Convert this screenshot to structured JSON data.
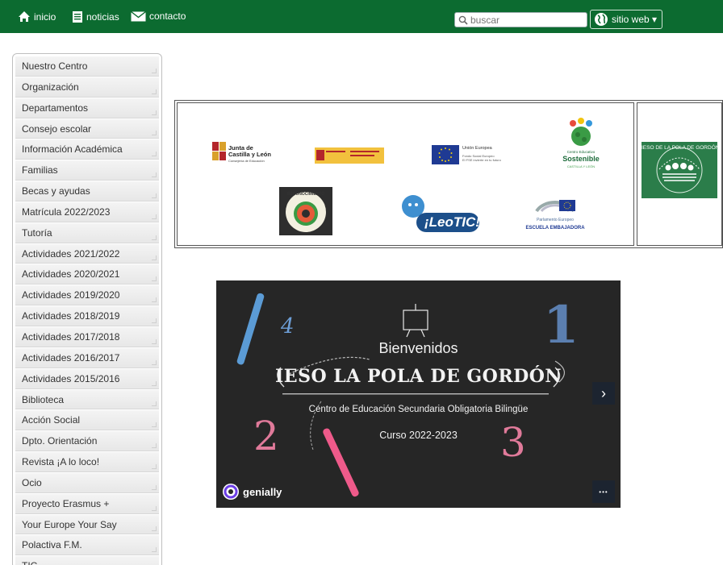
{
  "topbar": {
    "links": [
      {
        "label": "inicio",
        "icon": "home-icon"
      },
      {
        "label": "noticias",
        "icon": "document-icon"
      },
      {
        "label": "contacto",
        "icon": "envelope-icon"
      }
    ],
    "search": {
      "placeholder": "buscar",
      "icon": "search-icon"
    },
    "site_button": {
      "label": "sitio web ▾",
      "icon": "globe-icon"
    },
    "background": "#0c6b30"
  },
  "sidebar": {
    "items": [
      "Nuestro Centro",
      "Organización",
      "Departamentos",
      "Consejo escolar",
      "Información Académica",
      "Familias",
      "Becas y ayudas",
      "Matrícula 2022/2023",
      "Tutoría",
      "Actividades 2021/2022",
      "Actividades 2020/2021",
      "Actividades 2019/2020",
      "Actividades 2018/2019",
      "Actividades 2017/2018",
      "Actividades 2016/2017",
      "Actividades 2015/2016",
      "Biblioteca",
      "Acción Social",
      "Dpto. Orientación",
      "Revista ¡A lo loco!",
      "Ocio",
      "Proyecto Erasmus +",
      "Your Europe Your Say",
      "Polactiva F.M.",
      "TIC"
    ]
  },
  "logos": {
    "junta": {
      "line1": "Junta de",
      "line2": "Castilla y León",
      "line3": "Consejería de Educación"
    },
    "ue": {
      "line1": "Unión Europea",
      "line2": "Fondo Social Europeo",
      "line3": "El FSE invierte en tu futuro"
    },
    "sostenible": {
      "line1": "Centro Educativo",
      "line2": "Sostenible",
      "line3": "CASTILLA Y LEÓN"
    },
    "reconocimiento": {
      "label": "RECONOCIMIENTO"
    },
    "leotic": {
      "label": "¡LeoTIC!"
    },
    "parlamento": {
      "line1": "Parlamento Europeo",
      "line2": "ESCUELA EMBAJADORA"
    },
    "pola": {
      "label": "IESO DE LA POLA DE GORDÓN"
    }
  },
  "genially": {
    "welcome": "Bienvenidos",
    "school": "IESO LA POLA DE GORDÓN",
    "subtitle": "Centro de Educación Secundaria Obligatoria Bilingüe",
    "course": "Curso 2022-2023",
    "brand": "genially",
    "next": "›",
    "more": "•••",
    "numbers": [
      "4",
      "1",
      "2",
      "3"
    ]
  }
}
